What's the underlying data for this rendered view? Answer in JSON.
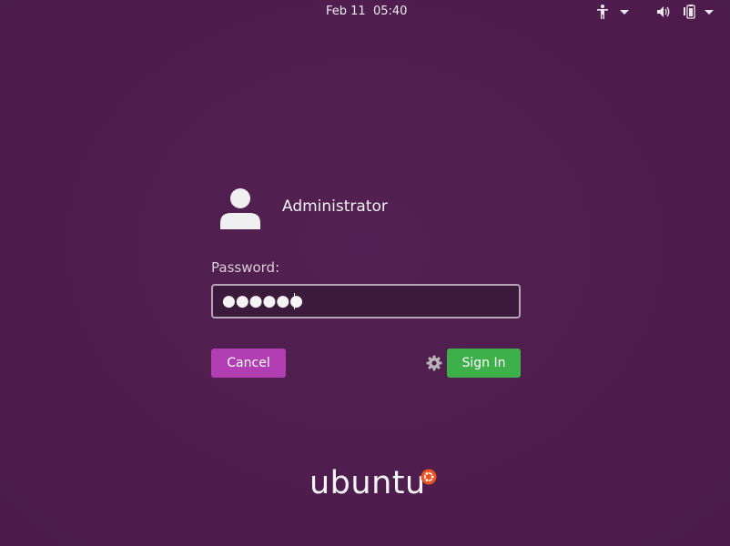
{
  "topbar": {
    "clock": "Feb 11  05:40",
    "icons": [
      "accessibility-icon",
      "chevron-down-icon",
      "volume-icon",
      "battery-icon",
      "chevron-down-icon"
    ]
  },
  "login": {
    "username": "Administrator",
    "password_label": "Password:",
    "password_mask": "●●●●●●",
    "cancel_label": "Cancel",
    "signin_label": "Sign In"
  },
  "branding": {
    "logo_text": "ubuntu"
  },
  "colors": {
    "background": "#4f1c4e",
    "cancel": "#b13fb3",
    "signin": "#3eb04a",
    "logo_mark": "#e95420"
  }
}
